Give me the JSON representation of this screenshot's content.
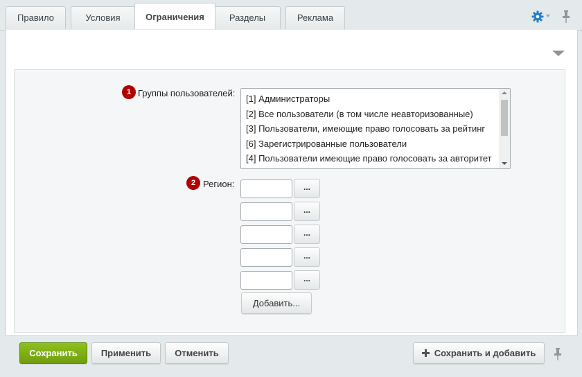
{
  "tabs": [
    {
      "label": "Правило"
    },
    {
      "label": "Условия"
    },
    {
      "label": "Ограничения",
      "active": true
    },
    {
      "label": "Разделы"
    },
    {
      "label": "Реклама"
    }
  ],
  "form": {
    "user_groups": {
      "badge": "1",
      "label": "Группы пользователей:",
      "options": [
        "[1] Администраторы",
        "[2] Все пользователи (в том числе неавторизованные)",
        "[3] Пользователи, имеющие право голосовать за рейтинг",
        "[6] Зарегистрированные пользователи",
        "[4] Пользователи имеющие право голосовать за авторитет"
      ]
    },
    "region": {
      "badge": "2",
      "label": "Регион:",
      "browse_label": "...",
      "inputs": [
        "",
        "",
        "",
        "",
        ""
      ],
      "add_label": "Добавить..."
    }
  },
  "footer": {
    "save_label": "Сохранить",
    "apply_label": "Применить",
    "cancel_label": "Отменить",
    "save_add_label": "Сохранить и добавить"
  },
  "colors": {
    "badge": "#b10000",
    "save_button": "#7cab14",
    "background": "#e4eaeb"
  },
  "icons": [
    "gear-icon",
    "chevron-down-icon",
    "pin-icon",
    "collapse-arrow-icon",
    "plus-icon"
  ]
}
